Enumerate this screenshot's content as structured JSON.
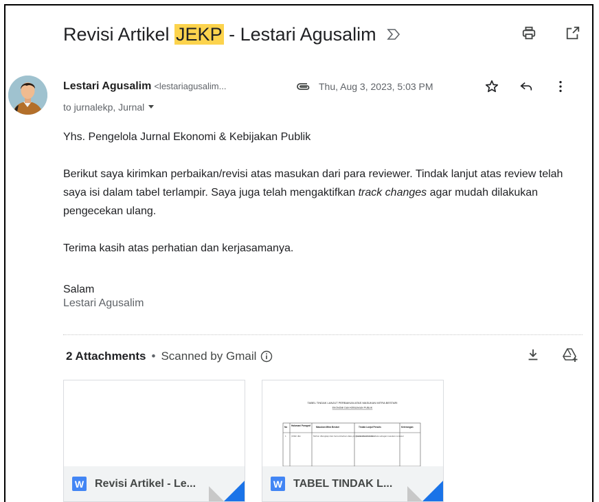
{
  "email": {
    "subject_before": "Revisi Artikel ",
    "subject_highlight": "JEKP",
    "subject_after": " - Lestari Agusalim",
    "sender_name": "Lestari Agusalim",
    "sender_email": "<lestariagusalim...",
    "date": "Thu, Aug 3, 2023, 5:03 PM",
    "recipients": "to jurnalekp, Jurnal",
    "greeting": "Yhs. Pengelola Jurnal Ekonomi & Kebijakan Publik",
    "para1_a": "Berikut saya kirimkan perbaikan/revisi atas masukan dari para reviewer. Tindak lanjut atas review telah saya isi dalam tabel terlampir. Saya juga telah mengaktifkan ",
    "para1_italic": "track changes",
    "para1_b": "  agar mudah dilakukan pengecekan ulang.",
    "para2": "Terima kasih atas perhatian dan kerjasamanya.",
    "closing": "Salam",
    "signature": "Lestari Agusalim"
  },
  "attachments": {
    "count_label": "2 Attachments",
    "separator": "•",
    "scanned_label": "Scanned by Gmail",
    "files": [
      {
        "badge": "W",
        "name": "Revisi Artikel - Le..."
      },
      {
        "badge": "W",
        "name": "TABEL TINDAK L..."
      }
    ]
  },
  "thumb2": {
    "title": "TABEL TINDAK LANJUT PERBAIKAN ATAS MASUKAN MITRA BESTARI",
    "subtitle": "EKONOMI DAN KEBIJAKAN PUBLIK",
    "headers": [
      "No",
      "Halaman/ Paragraf",
      "Masukan Mitra Bestari",
      "Tindak Lanjut Penulis",
      "Keterangan"
    ],
    "row_no": "1",
    "row_page": "(Ulfah dkk.",
    "row_masukan": "Mohon dilengkapi dan bersumberkan data yang tersedia dan terkini",
    "row_tindak": "Sudah ditambahkan data sebagai masukan reviewer"
  },
  "icons": {
    "important": "important-marker-icon",
    "print": "print-icon",
    "open_new": "open-in-new-icon",
    "attachment": "paperclip-icon",
    "star": "star-icon",
    "reply": "reply-icon",
    "more": "more-vert-icon",
    "dropdown": "dropdown-arrow-icon",
    "info": "info-icon",
    "download": "download-icon",
    "drive": "add-to-drive-icon"
  }
}
